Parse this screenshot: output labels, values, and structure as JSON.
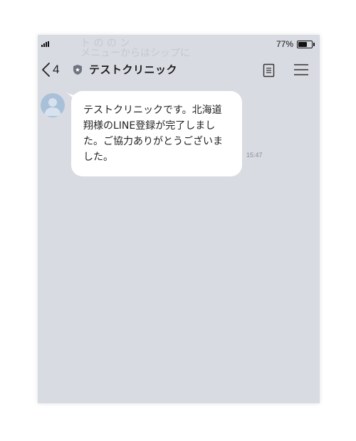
{
  "background_ghost": {
    "line1": "ト の   の   ン",
    "line2": "メニューからはシップに"
  },
  "status_bar": {
    "battery_percent": "77%",
    "battery_level": 0.77,
    "signal_icon": "cellular-signal-icon",
    "battery_icon": "battery-icon"
  },
  "header": {
    "back_icon": "chevron-left-icon",
    "unread_count": "4",
    "verified_icon": "shield-icon",
    "title": "テストクリニック",
    "notes_icon": "document-icon",
    "menu_icon": "hamburger-menu-icon"
  },
  "messages": [
    {
      "sender_avatar_icon": "default-avatar-icon",
      "text": "テストクリニックです。北海道翔様のLINE登録が完了しました。ご協力ありがとうございました。",
      "time": "15:47"
    }
  ],
  "colors": {
    "chat_background": "#d9dbe3",
    "bubble": "#ffffff",
    "avatar": "#a9c1d8",
    "text": "#222222"
  }
}
